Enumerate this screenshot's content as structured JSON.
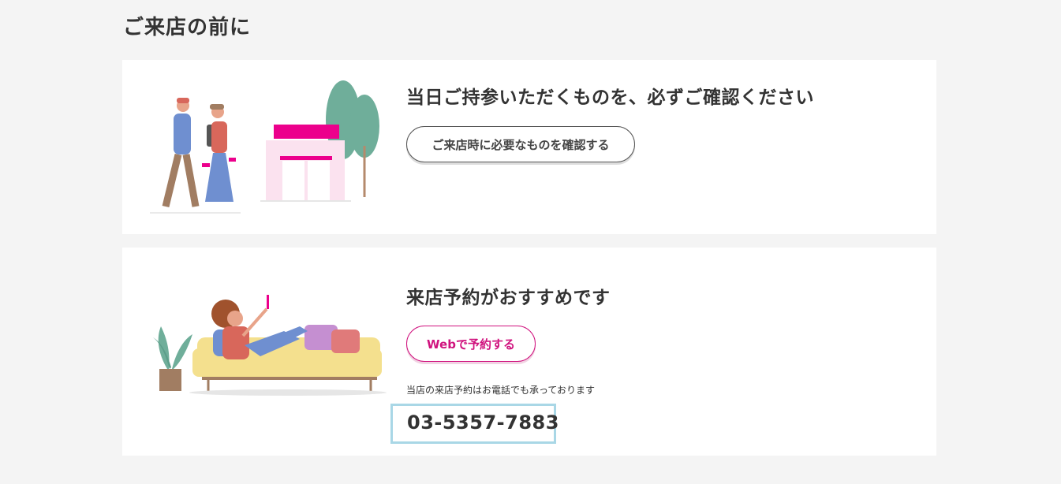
{
  "section": {
    "title": "ご来店の前に"
  },
  "card_items": {
    "heading": "当日ご持参いただくものを、必ずご確認ください",
    "button_label": "ご来店時に必要なものを確認する"
  },
  "card_reservation": {
    "heading": "来店予約がおすすめです",
    "button_label": "Webで予約する",
    "phone_note": "当店の来店予約はお電話でも承っております",
    "phone_number": "03-5357-7883"
  },
  "colors": {
    "accent": "#d0127e",
    "highlight": "#a9d7e6",
    "background": "#f4f4f4"
  }
}
